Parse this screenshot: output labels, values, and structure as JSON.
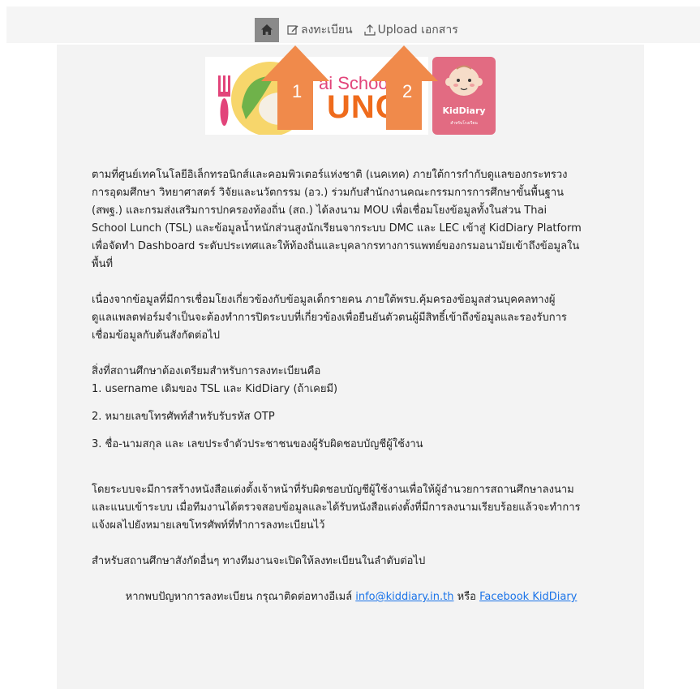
{
  "nav": {
    "register_label": "ลงทะเบียน",
    "upload_label": "Upload เอกสาร"
  },
  "logos": {
    "tsl_school_text": "ai Schoo",
    "tsl_lunch_text": "UNCH",
    "kiddiary_title": "KidDiary",
    "kiddiary_subtitle": "สำหรับโรงเรียน"
  },
  "annotations": {
    "arrow1": "1",
    "arrow2": "2"
  },
  "content": {
    "para1_lines": [
      "ตามที่ศูนย์เทคโนโลยีอิเล็กทรอนิกส์และคอมพิวเตอร์แห่งชาติ (เนคเทค) ภายใต้การกำกับดูแลของกระทรวง",
      "การอุดมศึกษา วิทยาศาสตร์ วิจัยและนวัตกรรม (อว.) ร่วมกับสำนักงานคณะกรรมการการศึกษาขั้นพื้นฐาน",
      "(สพฐ.) และกรมส่งเสริมการปกครองท้องถิ่น (สถ.) ได้ลงนาม MOU เพื่อเชื่อมโยงข้อมูลทั้งในส่วน Thai",
      "School Lunch (TSL) และข้อมูลน้ำหนักส่วนสูงนักเรียนจากระบบ DMC และ LEC เข้าสู่ KidDiary Platform",
      "เพื่อจัดทำ Dashboard ระดับประเทศและให้ท้องถิ่นและบุคลากรทางการแพทย์ของกรมอนามัยเข้าถึงข้อมูลใน",
      "พื้นที่"
    ],
    "para2_lines": [
      "เนื่องจากข้อมูลที่มีการเชื่อมโยงเกี่ยวข้องกับข้อมูลเด็กรายคน ภายใต้พรบ.คุ้มครองข้อมูลส่วนบุคคลทางผู้",
      "ดูแลแพลตฟอร์มจำเป็นจะต้องทำการปิดระบบที่เกี่ยวข้องเพื่อยืนยันตัวตนผู้มีสิทธิ์เข้าถึงข้อมูลและรองรับการ",
      "เชื่อมข้อมูลกับต้นสังกัดต่อไป"
    ],
    "prep_heading": "สิ่งที่สถานศึกษาต้องเตรียมสำหรับการลงทะเบียนคือ",
    "prep_item1": "1. username เดิมของ TSL และ KidDiary (ถ้าเคยมี)",
    "prep_item2": "2. หมายเลขโทรศัพท์สำหรับรับรหัส OTP",
    "prep_item3": "3. ชื่อ-นามสกุล และ เลขประจำตัวประชาชนของผู้รับผิดชอบบัญชีผู้ใช้งาน",
    "para3_lines": [
      "โดยระบบจะมีการสร้างหนังสือแต่งตั้งเจ้าหน้าที่รับผิดชอบบัญชีผู้ใช้งานเพื่อให้ผู้อำนวยการสถานศึกษาลงนาม",
      "และแนบเข้าระบบ เมื่อทีมงานได้ตรวจสอบข้อมูลและได้รับหนังสือแต่งตั้งที่มีการลงนามเรียบร้อยแล้วจะทำการ",
      "แจ้งผลไปยังหมายเลขโทรศัพท์ที่ทำการลงทะเบียนไว้"
    ],
    "para4": "สำหรับสถานศึกษาสังกัดอื่นๆ ทางทีมงานจะเปิดให้ลงทะเบียนในลำดับต่อไป",
    "contact_prefix": "หากพบปัญหาการลงทะเบียน กรุณาติดต่อทางอีเมล์ ",
    "contact_email": "info@kiddiary.in.th",
    "contact_or": " หรือ ",
    "contact_facebook": "Facebook KidDiary"
  },
  "colors": {
    "arrow": "#f08a4b",
    "link": "#1a73e8",
    "kiddiary_pink": "#e26b82"
  }
}
